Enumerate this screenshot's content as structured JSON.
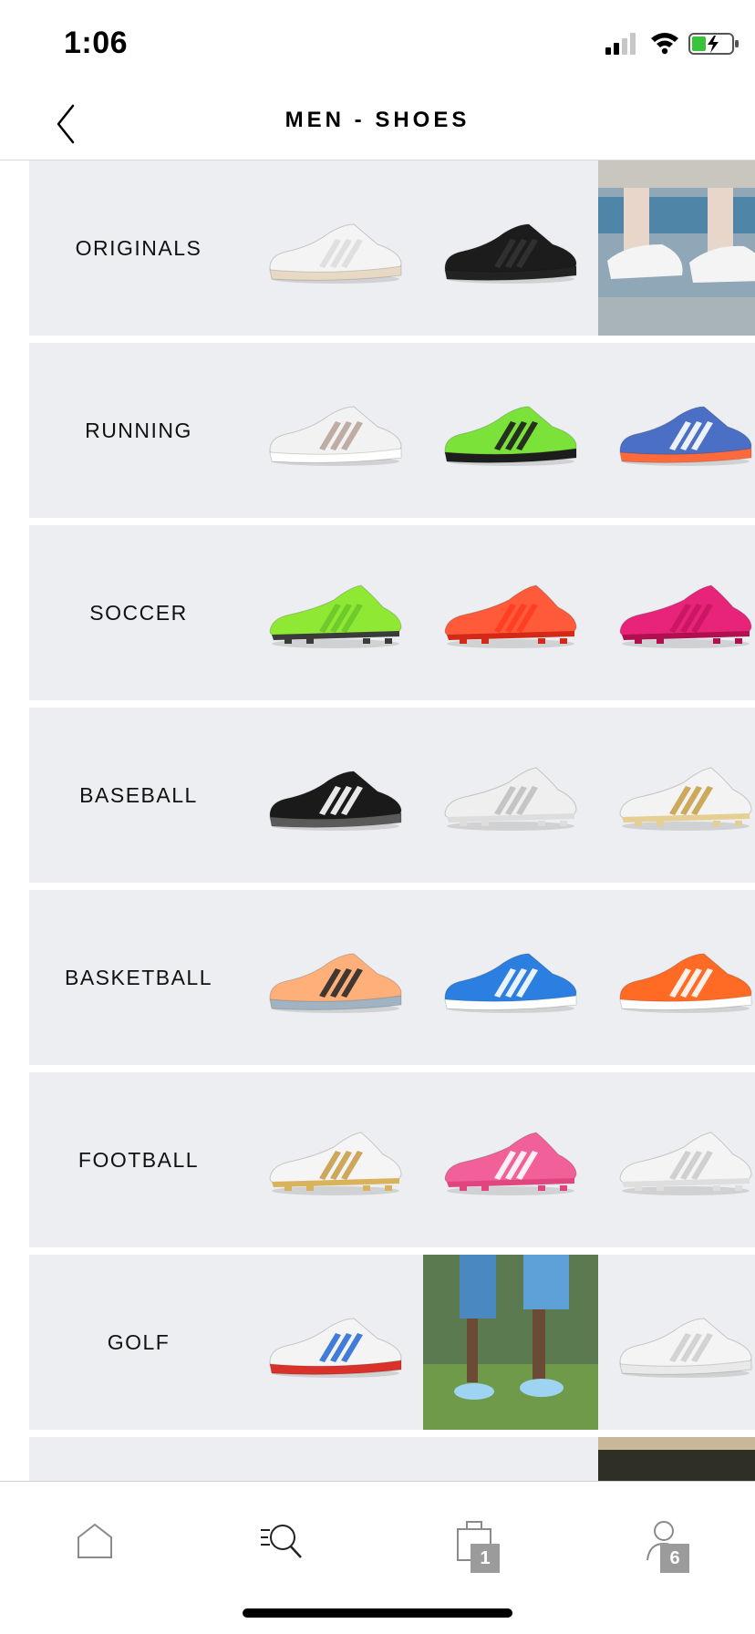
{
  "status_bar": {
    "time": "1:06"
  },
  "header": {
    "title": "MEN - SHOES"
  },
  "categories": [
    {
      "label": "ORIGINALS",
      "tiles": [
        {
          "kind": "shoe",
          "color": "#f4f4f4",
          "stripe": "#dddddd",
          "sole": "#e8d9c4"
        },
        {
          "kind": "shoe",
          "color": "#1c1c1c",
          "stripe": "#333333",
          "sole": "#222222"
        },
        {
          "kind": "photo",
          "theme": "sneakers-on-bench"
        }
      ]
    },
    {
      "label": "RUNNING",
      "tiles": [
        {
          "kind": "shoe",
          "color": "#f2f2f2",
          "stripe": "#b9a59a",
          "sole": "#ffffff"
        },
        {
          "kind": "shoe",
          "color": "#7be23a",
          "stripe": "#1d1d1d",
          "sole": "#1d1d1d"
        },
        {
          "kind": "shoe",
          "color": "#4a6fc4",
          "stripe": "#ffffff",
          "sole": "#ff6a3d"
        }
      ]
    },
    {
      "label": "SOCCER",
      "tiles": [
        {
          "kind": "cleat",
          "color": "#8fe934",
          "stripe": "#6cc82a",
          "sole": "#3b3b3b"
        },
        {
          "kind": "cleat",
          "color": "#ff5a3a",
          "stripe": "#ff3b22",
          "sole": "#d32a18"
        },
        {
          "kind": "cleat",
          "color": "#e8247a",
          "stripe": "#c81562",
          "sole": "#b0104f"
        }
      ]
    },
    {
      "label": "BASEBALL",
      "tiles": [
        {
          "kind": "shoe",
          "color": "#1a1a1a",
          "stripe": "#ffffff",
          "sole": "#5a5a5a"
        },
        {
          "kind": "cleat",
          "color": "#efefef",
          "stripe": "#c0c0c0",
          "sole": "#dddddd"
        },
        {
          "kind": "cleat",
          "color": "#f3f3f3",
          "stripe": "#c9a24a",
          "sole": "#e5cf94"
        }
      ]
    },
    {
      "label": "BASKETBALL",
      "tiles": [
        {
          "kind": "shoe",
          "color": "#ffb07a",
          "stripe": "#2a2a2a",
          "sole": "#9fb3c2"
        },
        {
          "kind": "shoe",
          "color": "#2a7fe0",
          "stripe": "#ffffff",
          "sole": "#ffffff"
        },
        {
          "kind": "shoe",
          "color": "#ff6a24",
          "stripe": "#ffffff",
          "sole": "#ffffff"
        }
      ]
    },
    {
      "label": "FOOTBALL",
      "tiles": [
        {
          "kind": "cleat",
          "color": "#f5f5f5",
          "stripe": "#c9a04a",
          "sole": "#d9b35c"
        },
        {
          "kind": "cleat",
          "color": "#f2609a",
          "stripe": "#ffffff",
          "sole": "#e0457f"
        },
        {
          "kind": "cleat",
          "color": "#f4f4f4",
          "stripe": "#cccccc",
          "sole": "#dedede"
        }
      ]
    },
    {
      "label": "GOLF",
      "tiles": [
        {
          "kind": "shoe",
          "color": "#f4f4f4",
          "stripe": "#2d6fd6",
          "sole": "#d8322a"
        },
        {
          "kind": "photo",
          "theme": "golfers-on-grass"
        },
        {
          "kind": "shoe",
          "color": "#f4f4f4",
          "stripe": "#cfcfcf",
          "sole": "#e9e9e9"
        }
      ]
    },
    {
      "label": "",
      "tiles": [
        {
          "kind": "empty"
        },
        {
          "kind": "empty"
        },
        {
          "kind": "photo",
          "theme": "partial-dark-photo"
        }
      ]
    }
  ],
  "tab_bar": {
    "items": [
      {
        "name": "home",
        "icon": "home-icon"
      },
      {
        "name": "search",
        "icon": "search-icon"
      },
      {
        "name": "bag",
        "icon": "shopping-bag-icon",
        "badge": "1"
      },
      {
        "name": "account",
        "icon": "account-icon",
        "badge": "6"
      }
    ]
  }
}
